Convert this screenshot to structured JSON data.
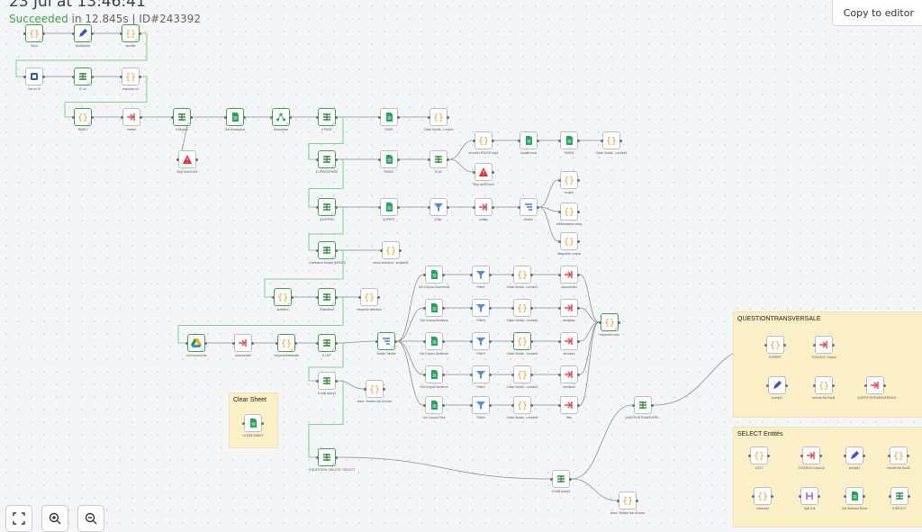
{
  "header": {
    "time": "23 Jul at 13:46:41",
    "status": "Succeeded",
    "meta": "in 12.845s | ID#243392",
    "copy_button": "Copy to editor"
  },
  "stickies": [
    {
      "title": "Clear Sheet"
    },
    {
      "title": "QUESTIONTRANSVERSALE"
    },
    {
      "title": "SELECT Entités"
    }
  ],
  "nodes": [
    {
      "icon": "code",
      "label": "Input",
      "ok": true
    },
    {
      "icon": "pencil",
      "label": "Description",
      "ok": true
    },
    {
      "icon": "code",
      "label": "encode",
      "ok": true
    },
    {
      "icon": "db",
      "label": "Get on ID",
      "ok": false
    },
    {
      "icon": "switch",
      "label": "IF url",
      "ok": true
    },
    {
      "icon": "code",
      "label": "response url",
      "ok": false
    },
    {
      "icon": "code",
      "label": "BASE1",
      "ok": true
    },
    {
      "icon": "redirect",
      "label": "rewrite",
      "ok": false
    },
    {
      "icon": "switch",
      "label": "If Mission",
      "ok": true
    },
    {
      "icon": "sheets",
      "label": "Get Description",
      "ok": true
    },
    {
      "icon": "share",
      "label": "Description",
      "ok": true
    },
    {
      "icon": "switch",
      "label": "If PAGE",
      "ok": true
    },
    {
      "icon": "sheets",
      "label": "PAGE",
      "ok": false
    },
    {
      "icon": "code",
      "label": "Clean Soldat - Lecture",
      "ok": false
    },
    {
      "icon": "warn",
      "label": "Stop and Error1",
      "ok": false
    },
    {
      "icon": "switch",
      "label": "If UPDATEPAGE",
      "ok": true
    },
    {
      "icon": "sheets",
      "label": "PAGE2",
      "ok": false
    },
    {
      "icon": "switch",
      "label": "If id3",
      "ok": false
    },
    {
      "icon": "code",
      "label": "encode UPDATE sup4",
      "ok": false
    },
    {
      "icon": "sheets",
      "label": "Update row4",
      "ok": false
    },
    {
      "icon": "sheets",
      "label": "PAGE5",
      "ok": false
    },
    {
      "icon": "code",
      "label": "Clean Soldat - Lecture5",
      "ok": false
    },
    {
      "icon": "warn",
      "label": "Stop and Error3",
      "ok": false
    },
    {
      "icon": "switch",
      "label": "If EXPERT",
      "ok": true
    },
    {
      "icon": "sheets",
      "label": "EXPERT",
      "ok": false
    },
    {
      "icon": "filter",
      "label": "Filter",
      "ok": false
    },
    {
      "icon": "redirect",
      "label": "entites",
      "ok": false
    },
    {
      "icon": "split",
      "label": "Switch",
      "ok": false
    },
    {
      "icon": "code",
      "label": "emploi",
      "ok": false
    },
    {
      "icon": "code",
      "label": "IntMetadonee array",
      "ok": false
    },
    {
      "icon": "code",
      "label": "Integration corpus",
      "ok": false
    },
    {
      "icon": "switch",
      "label": "If selection Scripte (DEBUT)",
      "ok": true
    },
    {
      "icon": "code",
      "label": "retour selection - scripteNE",
      "ok": false
    },
    {
      "icon": "code",
      "label": "selection",
      "ok": true
    },
    {
      "icon": "switch",
      "label": "If selection",
      "ok": true
    },
    {
      "icon": "code",
      "label": "response selection",
      "ok": false
    },
    {
      "icon": "sheets",
      "label": "Get Corpus Documents",
      "ok": false
    },
    {
      "icon": "filter",
      "label": "Filter1",
      "ok": false
    },
    {
      "icon": "code",
      "label": "Clean Soldat - Lecture1",
      "ok": false
    },
    {
      "icon": "redirect",
      "label": "documents1",
      "ok": false
    },
    {
      "icon": "sheets",
      "label": "Get Corpus Analyses",
      "ok": false
    },
    {
      "icon": "filter",
      "label": "Filter2",
      "ok": false
    },
    {
      "icon": "code",
      "label": "Clean Soldat - Lecture2",
      "ok": false
    },
    {
      "icon": "redirect",
      "label": "analyses",
      "ok": false
    },
    {
      "icon": "code",
      "label": "response route",
      "ok": true
    },
    {
      "icon": "drive",
      "label": "List Documents",
      "ok": true
    },
    {
      "icon": "redirect",
      "label": "documents2",
      "ok": false
    },
    {
      "icon": "code",
      "label": "responseMetadata",
      "ok": true
    },
    {
      "icon": "switch",
      "label": "If LIST",
      "ok": true
    },
    {
      "icon": "split",
      "label": "Switch Tabelle",
      "ok": true
    },
    {
      "icon": "sheets",
      "label": "Get Corpus Synthesis",
      "ok": false
    },
    {
      "icon": "filter",
      "label": "Filter3",
      "ok": false
    },
    {
      "icon": "code",
      "label": "Clean Soldat - Lecture3",
      "ok": true
    },
    {
      "icon": "redirect",
      "label": "structure",
      "ok": false
    },
    {
      "icon": "sheets",
      "label": "Get Corpus Mentions",
      "ok": false
    },
    {
      "icon": "filter",
      "label": "Filter4",
      "ok": false
    },
    {
      "icon": "code",
      "label": "Clean Soldat - Lecture4",
      "ok": false
    },
    {
      "icon": "redirect",
      "label": "mentions",
      "ok": false
    },
    {
      "icon": "switch",
      "label": "If valid query1",
      "ok": false
    },
    {
      "icon": "code",
      "label": "return Tentant non trouvee",
      "ok": false
    },
    {
      "icon": "sheets",
      "label": "Get Corpus Files",
      "ok": false
    },
    {
      "icon": "filter",
      "label": "Filter5",
      "ok": false
    },
    {
      "icon": "code",
      "label": "Clean Soldat - Lecture5",
      "ok": false
    },
    {
      "icon": "redirect",
      "label": "files",
      "ok": false
    },
    {
      "icon": "sheets",
      "label": "CLEAR SHEET",
      "ok": false
    },
    {
      "icon": "switch",
      "label": "If QUESTION / DELETE / SELECT",
      "ok": true
    },
    {
      "icon": "switch",
      "label": "If valid query2",
      "ok": false
    },
    {
      "icon": "code",
      "label": "return Tentant non trouvee",
      "ok": false
    },
    {
      "icon": "switch",
      "label": "QUESTIONTRANSVERS...",
      "ok": false
    },
    {
      "icon": "code",
      "label": "EXPERT",
      "ok": false
    },
    {
      "icon": "redirect",
      "label": "TOOLBOX Corpus",
      "ok": false
    },
    {
      "icon": "pencil",
      "label": "prompt1",
      "ok": false
    },
    {
      "icon": "code",
      "label": "encode Be.Saut1",
      "ok": false
    },
    {
      "icon": "redirect",
      "label": "QUESTIONTRANSVERSALE",
      "ok": false
    },
    {
      "icon": "code",
      "label": "LIST1",
      "ok": false
    },
    {
      "icon": "redirect",
      "label": "TOOLBOX Corpus2",
      "ok": false
    },
    {
      "icon": "pencil",
      "label": "prompt2",
      "ok": false
    },
    {
      "icon": "code",
      "label": "encode Be.Saut2",
      "ok": false
    },
    {
      "icon": "code",
      "label": "columns1",
      "ok": false
    },
    {
      "icon": "merge",
      "label": "Split Out",
      "ok": false
    },
    {
      "icon": "sheets",
      "label": "Get Selected Rows",
      "ok": false
    },
    {
      "icon": "switch",
      "label": "If SELECT",
      "ok": false
    }
  ],
  "zoom": {
    "fit": "fit-view",
    "in": "zoom-in",
    "out": "zoom-out"
  }
}
